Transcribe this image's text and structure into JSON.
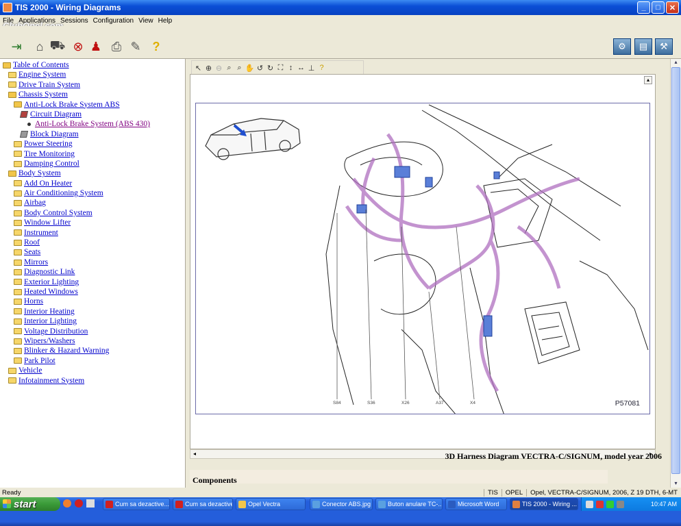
{
  "window": {
    "title": "TIS 2000 - Wiring Diagrams"
  },
  "menu": [
    "File",
    "Applications",
    "Sessions",
    "Configuration",
    "View",
    "Help"
  ],
  "watermark": "ClubOpel.com",
  "tree": [
    {
      "label": "Table of Contents",
      "level": 0,
      "icon": "open-folder-icon"
    },
    {
      "label": "Engine System",
      "level": 1,
      "icon": "folder-icon"
    },
    {
      "label": "Drive Train System",
      "level": 1,
      "icon": "folder-icon"
    },
    {
      "label": "Chassis System",
      "level": 1,
      "icon": "open-folder-icon"
    },
    {
      "label": "Anti-Lock Brake System ABS",
      "level": 2,
      "icon": "open-folder-icon"
    },
    {
      "label": "Circuit Diagram",
      "level": 3,
      "icon": "book-icon"
    },
    {
      "label": "Anti-Lock Brake System (ABS 430)",
      "level": 4,
      "icon": "bullet-icon",
      "selected": true
    },
    {
      "label": "Block Diagram",
      "level": 3,
      "icon": "book-icon"
    },
    {
      "label": "Power Steering",
      "level": 2,
      "icon": "folder-icon"
    },
    {
      "label": "Tire Monitoring",
      "level": 2,
      "icon": "folder-icon"
    },
    {
      "label": "Damping Control",
      "level": 2,
      "icon": "folder-icon"
    },
    {
      "label": "Body System",
      "level": 1,
      "icon": "open-folder-icon"
    },
    {
      "label": "Add On Heater",
      "level": 2,
      "icon": "folder-icon"
    },
    {
      "label": "Air Conditioning System",
      "level": 2,
      "icon": "folder-icon"
    },
    {
      "label": "Airbag",
      "level": 2,
      "icon": "folder-icon"
    },
    {
      "label": "Body Control System",
      "level": 2,
      "icon": "folder-icon"
    },
    {
      "label": "Window Lifter",
      "level": 2,
      "icon": "folder-icon"
    },
    {
      "label": "Instrument",
      "level": 2,
      "icon": "folder-icon"
    },
    {
      "label": "Roof",
      "level": 2,
      "icon": "folder-icon"
    },
    {
      "label": "Seats",
      "level": 2,
      "icon": "folder-icon"
    },
    {
      "label": "Mirrors",
      "level": 2,
      "icon": "folder-icon"
    },
    {
      "label": "Diagnostic Link",
      "level": 2,
      "icon": "folder-icon"
    },
    {
      "label": "Exterior Lighting",
      "level": 2,
      "icon": "folder-icon"
    },
    {
      "label": "Heated Windows",
      "level": 2,
      "icon": "folder-icon"
    },
    {
      "label": "Horns",
      "level": 2,
      "icon": "folder-icon"
    },
    {
      "label": "Interior Heating",
      "level": 2,
      "icon": "folder-icon"
    },
    {
      "label": "Interior Lighting",
      "level": 2,
      "icon": "folder-icon"
    },
    {
      "label": "Voltage Distribution",
      "level": 2,
      "icon": "folder-icon"
    },
    {
      "label": "Wipers/Washers",
      "level": 2,
      "icon": "folder-icon"
    },
    {
      "label": "Blinker & Hazard Warning",
      "level": 2,
      "icon": "folder-icon"
    },
    {
      "label": "Park Pilot",
      "level": 2,
      "icon": "folder-icon"
    },
    {
      "label": "Vehicle",
      "level": 1,
      "icon": "folder-icon"
    },
    {
      "label": "Infotainment System",
      "level": 1,
      "icon": "folder-icon"
    }
  ],
  "diagram": {
    "id": "P57081",
    "callouts": [
      "S84",
      "S36",
      "X26",
      "A37",
      "X4"
    ],
    "caption": "3D Harness Diagram VECTRA-C/SIGNUM, model year 2006",
    "components_heading": "Components",
    "harness_color": "#b070c0"
  },
  "status": {
    "left": "Ready",
    "fields": [
      "TIS",
      "OPEL",
      "Opel, VECTRA-C/SIGNUM, 2006, Z 19 DTH, 6-MT"
    ]
  },
  "taskbar": {
    "start": "start",
    "tasks": [
      {
        "label": "Cum sa dezactive...",
        "icon": "opera-icon"
      },
      {
        "label": "Cum sa dezactive...",
        "icon": "opera-icon"
      },
      {
        "label": "Opel Vectra",
        "icon": "folder-icon"
      },
      {
        "label": "Conector ABS.jpg ...",
        "icon": "image-icon"
      },
      {
        "label": "Buton anulare TC-...",
        "icon": "image-icon"
      },
      {
        "label": "Microsoft Word",
        "icon": "word-icon"
      },
      {
        "label": "TIS 2000 - Wiring ...",
        "icon": "tis-icon",
        "active": true
      }
    ],
    "clock": "10:47 AM"
  }
}
